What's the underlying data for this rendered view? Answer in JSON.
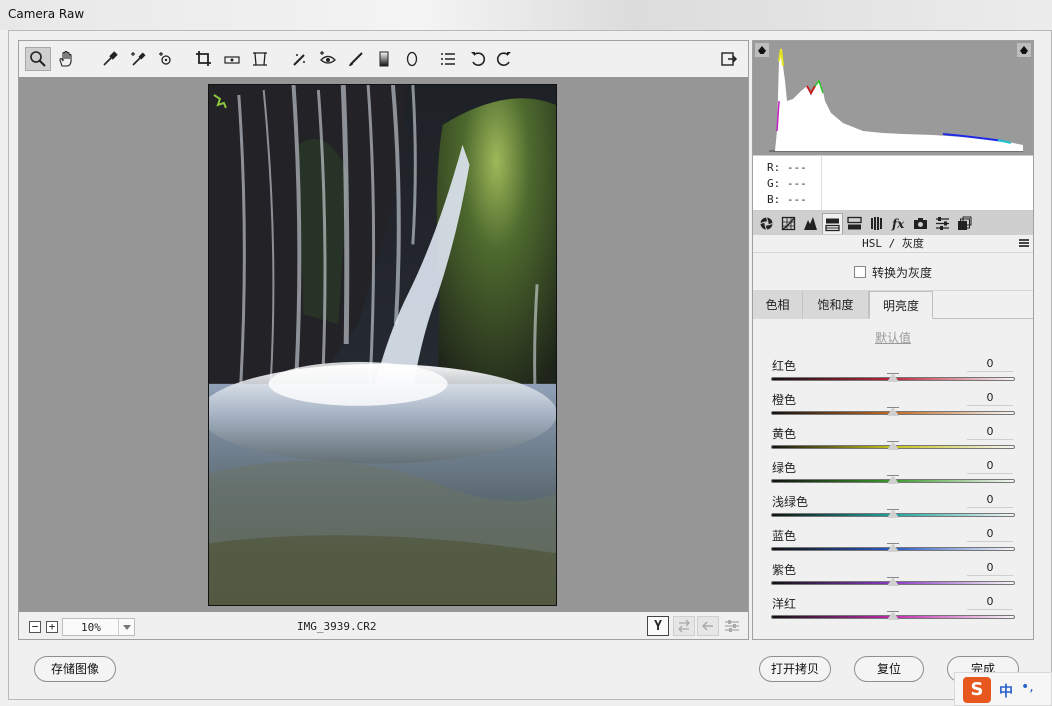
{
  "window": {
    "title": "Camera Raw"
  },
  "toolbar": {
    "tools": [
      {
        "name": "zoom-tool",
        "icon": "magnifier-icon",
        "active": true
      },
      {
        "name": "hand-tool",
        "icon": "hand-icon"
      },
      {
        "name": "white-balance-tool",
        "icon": "eyedropper-icon"
      },
      {
        "name": "color-sampler-tool",
        "icon": "eyedropper-plus-icon"
      },
      {
        "name": "targeted-adjustment-tool",
        "icon": "target-adjust-icon"
      },
      {
        "name": "crop-tool",
        "icon": "crop-icon"
      },
      {
        "name": "straighten-tool",
        "icon": "level-icon"
      },
      {
        "name": "transform-tool",
        "icon": "transform-icon"
      },
      {
        "name": "spot-removal-tool",
        "icon": "brush-heal-icon"
      },
      {
        "name": "red-eye-tool",
        "icon": "eye-icon"
      },
      {
        "name": "adjustment-brush-tool",
        "icon": "brush-icon"
      },
      {
        "name": "graduated-filter-tool",
        "icon": "gradient-icon"
      },
      {
        "name": "radial-filter-tool",
        "icon": "ellipse-icon"
      },
      {
        "name": "preferences-tool",
        "icon": "list-icon"
      },
      {
        "name": "rotate-left-tool",
        "icon": "rotate-ccw-icon"
      },
      {
        "name": "rotate-right-tool",
        "icon": "rotate-cw-icon"
      }
    ],
    "open_in_photoshop_icon": "export-icon"
  },
  "status": {
    "zoom_out": "−",
    "zoom_in": "+",
    "zoom": "10%",
    "filename": "IMG_3939.CR2",
    "compare_label": "Y"
  },
  "rgb": {
    "r": "R: ---",
    "g": "G: ---",
    "b": "B: ---"
  },
  "panel": {
    "title": "HSL / 灰度",
    "convert_grayscale": "转换为灰度",
    "subtabs": [
      "色相",
      "饱和度",
      "明亮度"
    ],
    "active_subtab": 2,
    "default_label": "默认值",
    "sliders": [
      {
        "label": "红色",
        "value": "0",
        "color": "#c0243a"
      },
      {
        "label": "橙色",
        "value": "0",
        "color": "#c66a1e"
      },
      {
        "label": "黄色",
        "value": "0",
        "color": "#c7c21c"
      },
      {
        "label": "绿色",
        "value": "0",
        "color": "#3a9a2a"
      },
      {
        "label": "浅绿色",
        "value": "0",
        "color": "#1aa6a0"
      },
      {
        "label": "蓝色",
        "value": "0",
        "color": "#2a5ac8"
      },
      {
        "label": "紫色",
        "value": "0",
        "color": "#8a3ac8"
      },
      {
        "label": "洋红",
        "value": "0",
        "color": "#c42ab0"
      }
    ]
  },
  "buttons": {
    "save": "存储图像",
    "open_copy": "打开拷贝",
    "reset": "复位",
    "done": "完成"
  },
  "ime": {
    "logo": "S",
    "lang": "中",
    "punct": "•,"
  }
}
